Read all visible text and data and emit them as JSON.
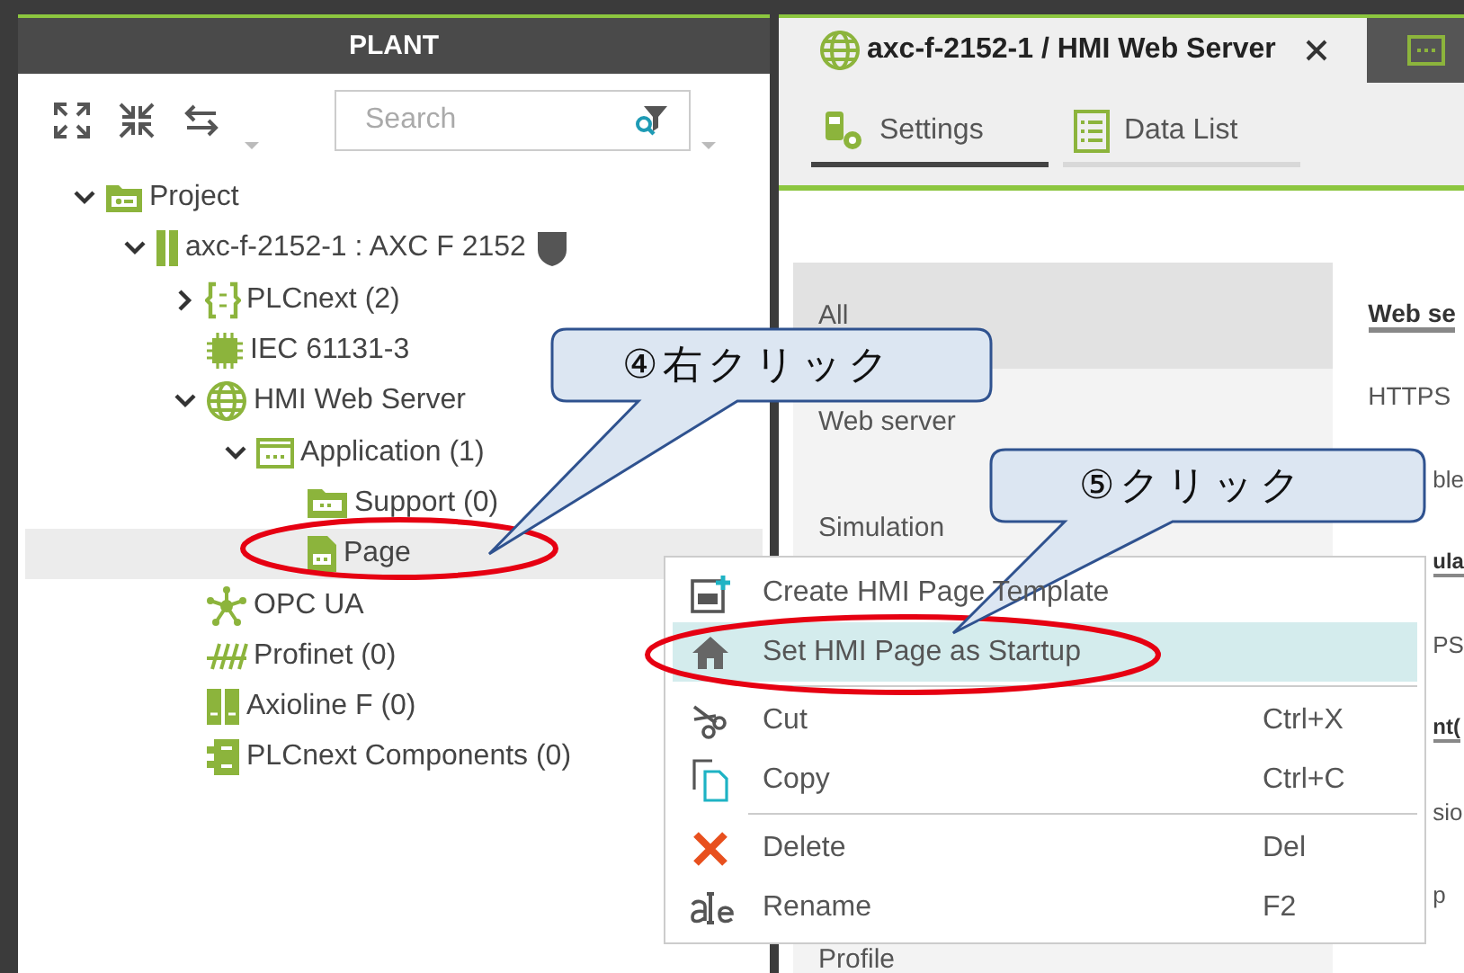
{
  "plant_panel": {
    "title": "PLANT",
    "search": {
      "placeholder": "Search"
    },
    "tree": [
      {
        "label": "Project",
        "kind": "project",
        "expanded": true,
        "selected": false,
        "children": [
          {
            "label": "axc-f-2152-1 : AXC F 2152",
            "kind": "device",
            "expanded": true,
            "selected": false,
            "children": [
              {
                "label": "PLCnext (2)",
                "kind": "plcnext",
                "expanded": false,
                "selected": false
              },
              {
                "label": "IEC 61131-3",
                "kind": "iec",
                "selected": false
              },
              {
                "label": "HMI Web Server",
                "kind": "hmi",
                "expanded": true,
                "selected": false,
                "children": [
                  {
                    "label": "Application (1)",
                    "kind": "application",
                    "expanded": true,
                    "selected": false,
                    "children": [
                      {
                        "label": "Support (0)",
                        "kind": "support",
                        "selected": false
                      },
                      {
                        "label": "Page",
                        "kind": "page",
                        "selected": true
                      }
                    ]
                  }
                ]
              },
              {
                "label": "OPC UA",
                "kind": "opcua",
                "selected": false
              },
              {
                "label": "Profinet (0)",
                "kind": "profinet",
                "selected": false
              },
              {
                "label": "Axioline F (0)",
                "kind": "axioline",
                "selected": false
              },
              {
                "label": "PLCnext Components (0)",
                "kind": "components",
                "selected": false
              }
            ]
          }
        ]
      }
    ]
  },
  "editor": {
    "tabs": [
      {
        "label": "axc-f-2152-1 / HMI Web Server",
        "selected": true
      },
      {
        "selected": false
      }
    ],
    "subtabs": [
      {
        "label": "Settings",
        "selected": true
      },
      {
        "label": "Data List",
        "selected": false
      }
    ],
    "categories": [
      {
        "label": "All",
        "selected": true
      },
      {
        "label": "Web server",
        "selected": false
      },
      {
        "label": "Simulation",
        "selected": false
      },
      {
        "label": "Profile",
        "selected": false
      }
    ],
    "settings": [
      {
        "text": "Web se",
        "kind": "heading"
      },
      {
        "text": "HTTPS",
        "kind": "label"
      },
      {
        "text": "ble",
        "kind": "partial-label"
      },
      {
        "text": "ula",
        "kind": "partial-heading"
      },
      {
        "text": "PS",
        "kind": "partial-label"
      },
      {
        "text": "nt(",
        "kind": "partial-heading"
      },
      {
        "text": "sio",
        "kind": "partial-label"
      },
      {
        "text": "p",
        "kind": "partial-label"
      }
    ]
  },
  "context_menu": {
    "sections": [
      {
        "items": [
          {
            "label": "Create HMI Page Template",
            "selected": false
          },
          {
            "label": "Set HMI Page as Startup",
            "selected": true
          }
        ]
      },
      {
        "items": [
          {
            "label": "Cut",
            "shortcut": "Ctrl+X",
            "selected": false
          },
          {
            "label": "Copy",
            "shortcut": "Ctrl+C",
            "selected": false
          }
        ]
      },
      {
        "items": [
          {
            "label": "Delete",
            "shortcut": "Del",
            "selected": false
          },
          {
            "label": "Rename",
            "shortcut": "F2",
            "selected": false
          }
        ]
      }
    ]
  },
  "annotations": [
    {
      "text": "④右クリック"
    },
    {
      "text": "⑤クリック"
    }
  ]
}
